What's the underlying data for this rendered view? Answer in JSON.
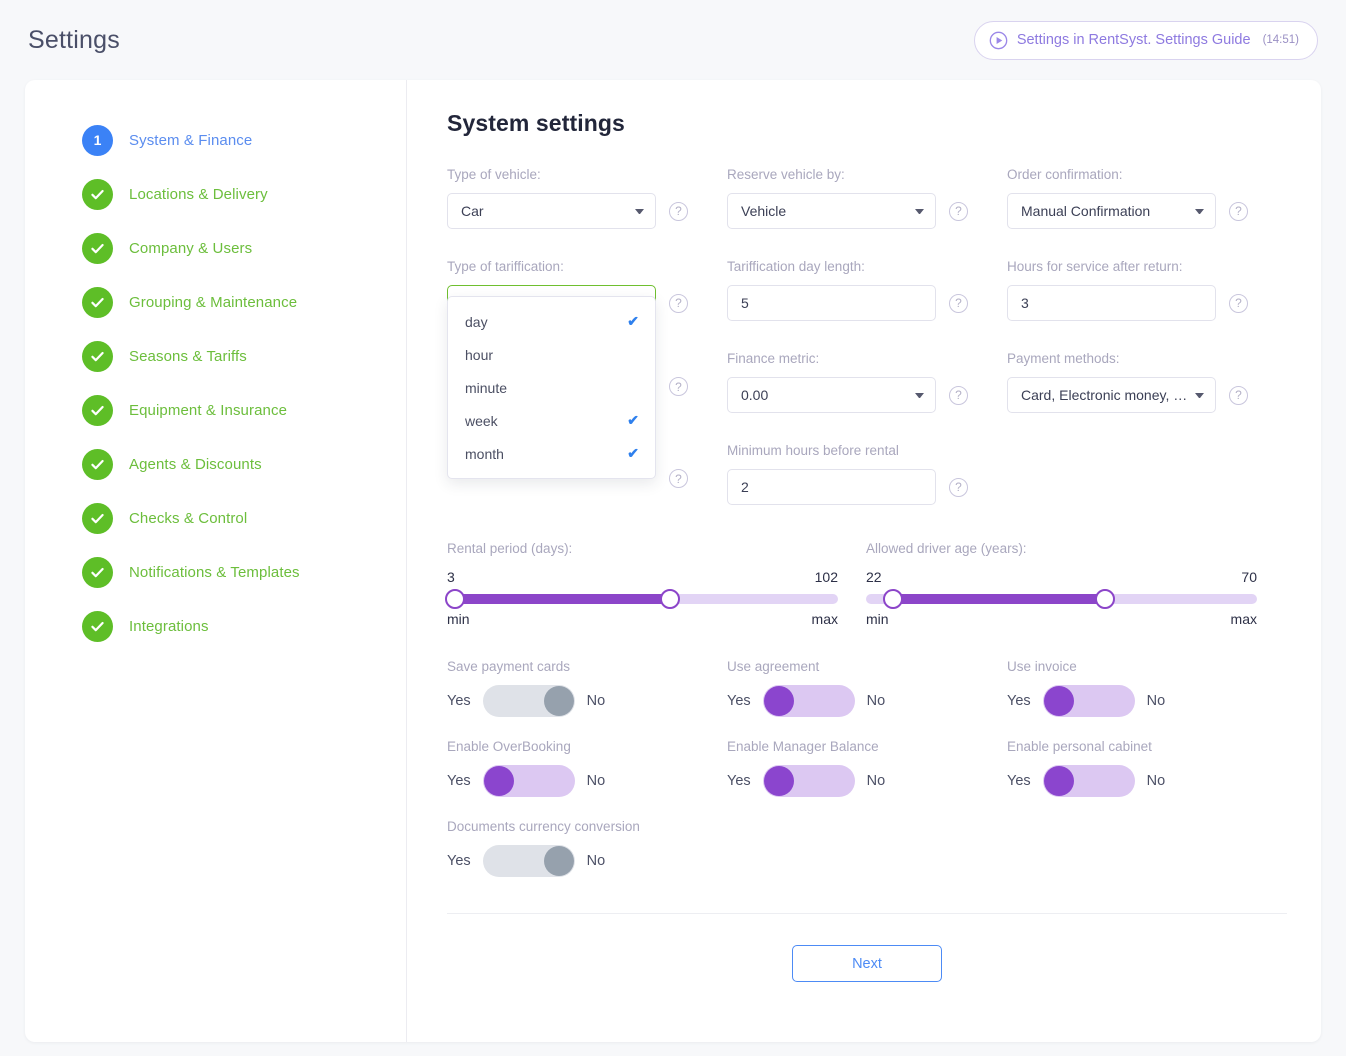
{
  "header": {
    "title": "Settings",
    "guide_button": {
      "icon": "play-circle-icon",
      "label": "Settings in RentSyst. Settings Guide",
      "duration": "(14:51)"
    }
  },
  "sidebar": {
    "items": [
      {
        "badge": "1",
        "state": "active",
        "label": "System & Finance"
      },
      {
        "badge": "check",
        "state": "done",
        "label": "Locations & Delivery"
      },
      {
        "badge": "check",
        "state": "done",
        "label": "Company & Users"
      },
      {
        "badge": "check",
        "state": "done",
        "label": "Grouping & Maintenance"
      },
      {
        "badge": "check",
        "state": "done",
        "label": "Seasons & Tariffs"
      },
      {
        "badge": "check",
        "state": "done",
        "label": "Equipment & Insurance"
      },
      {
        "badge": "check",
        "state": "done",
        "label": "Agents & Discounts"
      },
      {
        "badge": "check",
        "state": "done",
        "label": "Checks & Control"
      },
      {
        "badge": "check",
        "state": "done",
        "label": "Notifications & Templates"
      },
      {
        "badge": "check",
        "state": "done",
        "label": "Integrations"
      }
    ]
  },
  "main": {
    "heading": "System settings",
    "help_icon": "?",
    "fields": [
      {
        "label": "Type of vehicle:",
        "value": "Car",
        "type": "select"
      },
      {
        "label": "Reserve vehicle by:",
        "value": "Vehicle",
        "type": "select"
      },
      {
        "label": "Order confirmation:",
        "value": "Manual Confirmation",
        "type": "select"
      },
      {
        "label": "Type of tariffication:",
        "value": "day, week, month",
        "type": "select"
      },
      {
        "label": "Tariffication day length:",
        "value": "5",
        "type": "text"
      },
      {
        "label": "Hours for service after return:",
        "value": "3",
        "type": "text"
      },
      {
        "label": "Finance metric:",
        "value": "0.00",
        "type": "select"
      },
      {
        "label": "Payment methods:",
        "value": "Card, Electronic money, Ba…",
        "type": "select"
      },
      {
        "label": "Minimum hours before rental",
        "value": "2",
        "type": "text"
      }
    ],
    "dropdown": {
      "open_for": "Type of tariffication:",
      "options": [
        {
          "label": "day",
          "checked": true
        },
        {
          "label": "hour",
          "checked": false
        },
        {
          "label": "minute",
          "checked": false
        },
        {
          "label": "week",
          "checked": true
        },
        {
          "label": "month",
          "checked": true
        }
      ]
    },
    "sliders": [
      {
        "label": "Rental period (days):",
        "min_value": "3",
        "max_value": "102",
        "min_caption": "min",
        "max_caption": "max",
        "handle_left_pct": 2,
        "handle_right_pct": 57
      },
      {
        "label": "Allowed driver age (years):",
        "min_value": "22",
        "max_value": "70",
        "min_caption": "min",
        "max_caption": "max",
        "handle_left_pct": 7,
        "handle_right_pct": 61
      }
    ],
    "toggles": [
      {
        "label": "Save payment cards",
        "yes": "Yes",
        "no": "No",
        "state": "off"
      },
      {
        "label": "Use agreement",
        "yes": "Yes",
        "no": "No",
        "state": "on"
      },
      {
        "label": "Use invoice",
        "yes": "Yes",
        "no": "No",
        "state": "on"
      },
      {
        "label": "Enable OverBooking",
        "yes": "Yes",
        "no": "No",
        "state": "on"
      },
      {
        "label": "Enable Manager Balance",
        "yes": "Yes",
        "no": "No",
        "state": "on"
      },
      {
        "label": "Enable personal cabinet",
        "yes": "Yes",
        "no": "No",
        "state": "on"
      },
      {
        "label": "Documents currency conversion",
        "yes": "Yes",
        "no": "No",
        "state": "off"
      }
    ],
    "next_button": "Next"
  },
  "colors": {
    "accent_blue": "#3b82f6",
    "success_green": "#5ebe27",
    "purple": "#8b45ce",
    "purple_track": "#dcc8f2",
    "focus_green": "#6fbf2f",
    "guide_purple": "#8e7ae0"
  }
}
